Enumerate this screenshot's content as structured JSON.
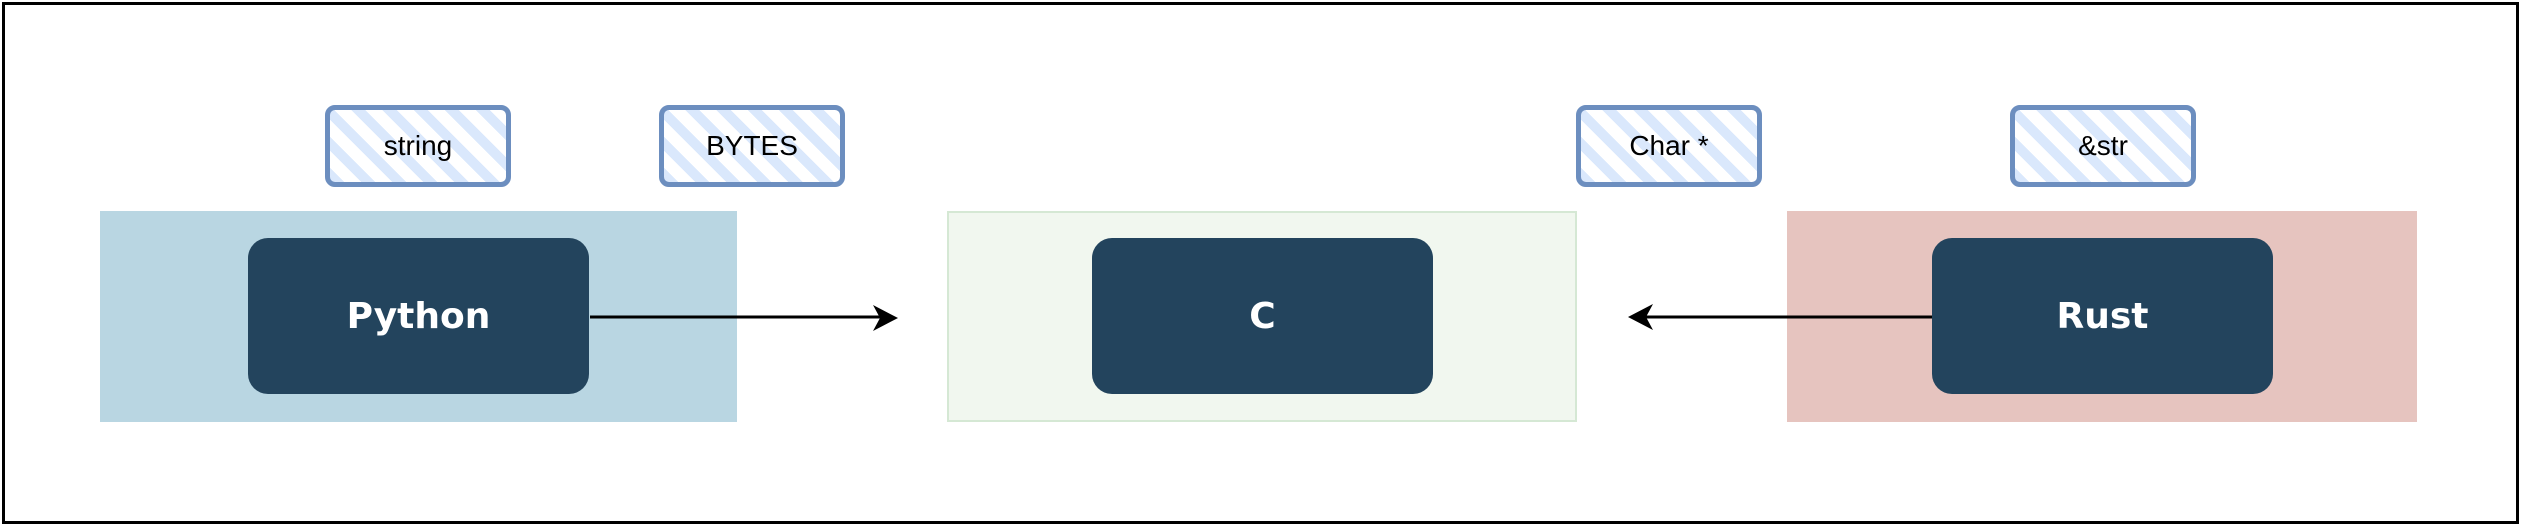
{
  "nodes": {
    "python": "Python",
    "c": "C",
    "rust": "Rust"
  },
  "tags": {
    "string": "string",
    "bytes": "BYTES",
    "char_ptr": "Char *",
    "str_ref": "&str"
  },
  "colors": {
    "python_bg": "#b9d6e2",
    "c_bg": "#f1f7ef",
    "rust_bg": "#e6c4bf",
    "node": "#23445d",
    "tag_border": "#6c8ebf",
    "tag_fill": "#dae8fc"
  }
}
